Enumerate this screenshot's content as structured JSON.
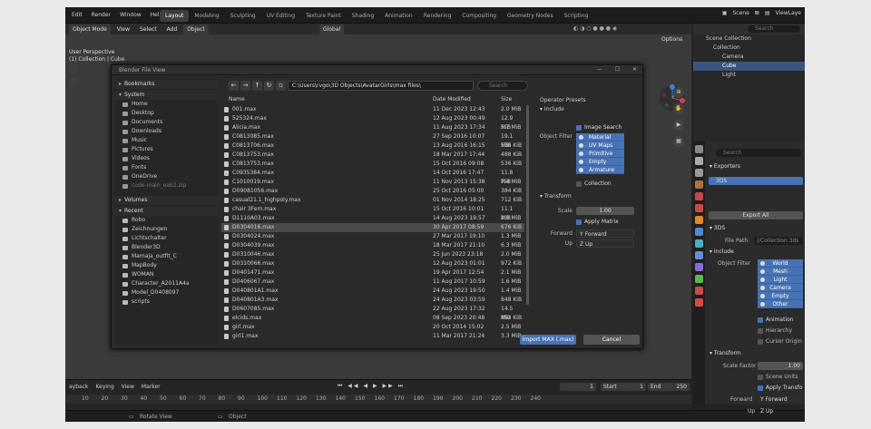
{
  "menu": [
    "Edit",
    "Render",
    "Window",
    "Help"
  ],
  "workspaces": [
    "Layout",
    "Modeling",
    "Sculpting",
    "UV Editing",
    "Texture Paint",
    "Shading",
    "Animation",
    "Rendering",
    "Compositing",
    "Geometry Nodes",
    "Scripting"
  ],
  "top_right": {
    "scene": "Scene",
    "view_layer": "ViewLaye"
  },
  "viewport_header": {
    "mode": "Object Mode",
    "items": [
      "View",
      "Select",
      "Add",
      "Object"
    ],
    "transform": "Global"
  },
  "viewport_info": {
    "line1": "User Perspective",
    "line2": "(1) Collection | Cube"
  },
  "options_label": "Options",
  "gizmo": {
    "x": "X",
    "y": "Y",
    "z": "Z"
  },
  "file_browser": {
    "title": "Blender File View",
    "path": "C:\\Users\\rvgo\\3D Objects\\AvatarGirls\\max files\\",
    "search_placeholder": "Search",
    "bookmarks_label": "Bookmarks",
    "system_label": "System",
    "system_items": [
      "Home",
      "Desktop",
      "Documents",
      "Downloads",
      "Music",
      "Pictures",
      "Videos",
      "Fonts",
      "OneDrive",
      "code-main_eab2.zip"
    ],
    "volumes_label": "Volumes",
    "recent_label": "Recent",
    "recent_items": [
      "Robo",
      "Zeichnungen",
      "Lichtschalter",
      "Blender3D",
      "Mamaja_outfit_C",
      "MapBody",
      "WOMAN",
      "Character_A2011A4a",
      "Model_D0408097",
      "scripts"
    ],
    "columns": {
      "name": "Name",
      "date": "Date Modified",
      "size": "Size"
    },
    "files": [
      {
        "name": "001.max",
        "date": "11 Dec 2023 12:43",
        "size": "2.0 MiB"
      },
      {
        "name": "525324.max",
        "date": "12 Aug 2023 00:49",
        "size": "12.9 MiB"
      },
      {
        "name": "Alicia.max",
        "date": "11 Aug 2023 17:34",
        "size": "5.7 MiB"
      },
      {
        "name": "C0813085.max",
        "date": "27 Sep 2016 10:07",
        "size": "19.1 MiB"
      },
      {
        "name": "C0813706.max",
        "date": "13 Aug 2016 16:15",
        "size": "536 KiB"
      },
      {
        "name": "C0813753.max",
        "date": "18 Mar 2017 17:44",
        "size": "488 KiB"
      },
      {
        "name": "C0813753.max",
        "date": "15 Oct 2016 09:08",
        "size": "536 KiB"
      },
      {
        "name": "C0935384.max",
        "date": "14 Oct 2016 17:47",
        "size": "11.8 MiB"
      },
      {
        "name": "C1010019.max",
        "date": "11 Nov 2013 15:38",
        "size": "7.4 MiB"
      },
      {
        "name": "D09081056.max",
        "date": "25 Oct 2016 05:00",
        "size": "384 KiB"
      },
      {
        "name": "casual21.1_highpoly.max",
        "date": "01 Nov 2014 18:25",
        "size": "712 KiB"
      },
      {
        "name": "chair 3Fem.max",
        "date": "15 Oct 2016 10:01",
        "size": "11.1 MiB"
      },
      {
        "name": "D1110A03.max",
        "date": "14 Aug 2023 19:57",
        "size": "2.0 MiB"
      },
      {
        "name": "D0304016.max",
        "date": "30 Apr 2017 08:59",
        "size": "676 KiB"
      },
      {
        "name": "D0304024.max",
        "date": "27 Mar 2017 19:10",
        "size": "1.3 MiB"
      },
      {
        "name": "D0304039.max",
        "date": "18 Mar 2017 21:10",
        "size": "6.3 MiB"
      },
      {
        "name": "D0310046.max",
        "date": "25 Jun 2023 23:18",
        "size": "2.0 MiB"
      },
      {
        "name": "D0310066.max",
        "date": "12 Aug 2023 01:01",
        "size": "972 KiB"
      },
      {
        "name": "D0401471.max",
        "date": "19 Apr 2017 12:54",
        "size": "2.1 MiB"
      },
      {
        "name": "D0406067.max",
        "date": "11 Aug 2017 10:59",
        "size": "1.6 MiB"
      },
      {
        "name": "D040801A1.max",
        "date": "24 Aug 2023 19:50",
        "size": "1.4 MiB"
      },
      {
        "name": "D040801A3.max",
        "date": "24 Aug 2023 03:59",
        "size": "848 KiB"
      },
      {
        "name": "D0607085.max",
        "date": "22 Aug 2023 17:32",
        "size": "14.5 MiB"
      },
      {
        "name": "elcids.max",
        "date": "08 Sep 2023 20:48",
        "size": "852 KiB"
      },
      {
        "name": "girl.max",
        "date": "20 Oct 2014 15:02",
        "size": "2.5 MiB"
      },
      {
        "name": "girl1.max",
        "date": "11 Mar 2017 21:24",
        "size": "3.3 MiB"
      }
    ],
    "right": {
      "operator_presets": "Operator Presets",
      "include_label": "Include",
      "image_search": "Image Search",
      "object_filter": "Object Filter",
      "filters": [
        "Material",
        "UV Maps",
        "Primitive",
        "Empty",
        "Armature"
      ],
      "collection": "Collection",
      "transform_label": "Transform",
      "scale_label": "Scale",
      "scale_value": "1.00",
      "apply_matrix": "Apply Matrix",
      "forward_label": "Forward",
      "forward_value": "Y Forward",
      "up_label": "Up",
      "up_value": "Z Up",
      "import_btn": "Import MAX (.max)",
      "cancel_btn": "Cancel"
    }
  },
  "outliner": {
    "search_placeholder": "Search",
    "items": [
      "Scene Collection",
      "Collection",
      "Camera",
      "Cube",
      "Light"
    ]
  },
  "properties": {
    "search_placeholder": "Search",
    "exporters_label": "Exporters",
    "exporter_item": "3DS",
    "export_all": "Export All",
    "section_3ds": "3DS",
    "file_path_label": "File Path",
    "file_path_value": "//Collection.3ds",
    "include_label": "Include",
    "object_filter_label": "Object Filter",
    "filters": [
      "World",
      "Mesh",
      "Light",
      "Camera",
      "Empty",
      "Other"
    ],
    "animation": "Animation",
    "hierarchy": "Hierarchy",
    "cursor_origin": "Cursor Origin",
    "transform_label": "Transform",
    "scale_factor_label": "Scale Factor",
    "scale_factor_value": "1.00",
    "scene_units": "Scene Units",
    "apply_transform": "Apply Transfo",
    "forward_label": "Forward",
    "forward_value": "Y Forward",
    "up_label": "Up",
    "up_value": "Z Up"
  },
  "timeline": {
    "menu": [
      "ayback",
      "Keying",
      "View",
      "Marker"
    ],
    "current_frame": "1",
    "start_label": "Start",
    "start_value": "1",
    "end_label": "End",
    "end_value": "250",
    "ruler": [
      "10",
      "20",
      "30",
      "40",
      "50",
      "60",
      "70",
      "80",
      "90",
      "100",
      "110",
      "120",
      "130",
      "140",
      "150",
      "160",
      "170",
      "180",
      "190",
      "200",
      "210",
      "220",
      "230",
      "240"
    ]
  },
  "statusbar": {
    "rotate": "Rotate View",
    "object": "Object"
  }
}
